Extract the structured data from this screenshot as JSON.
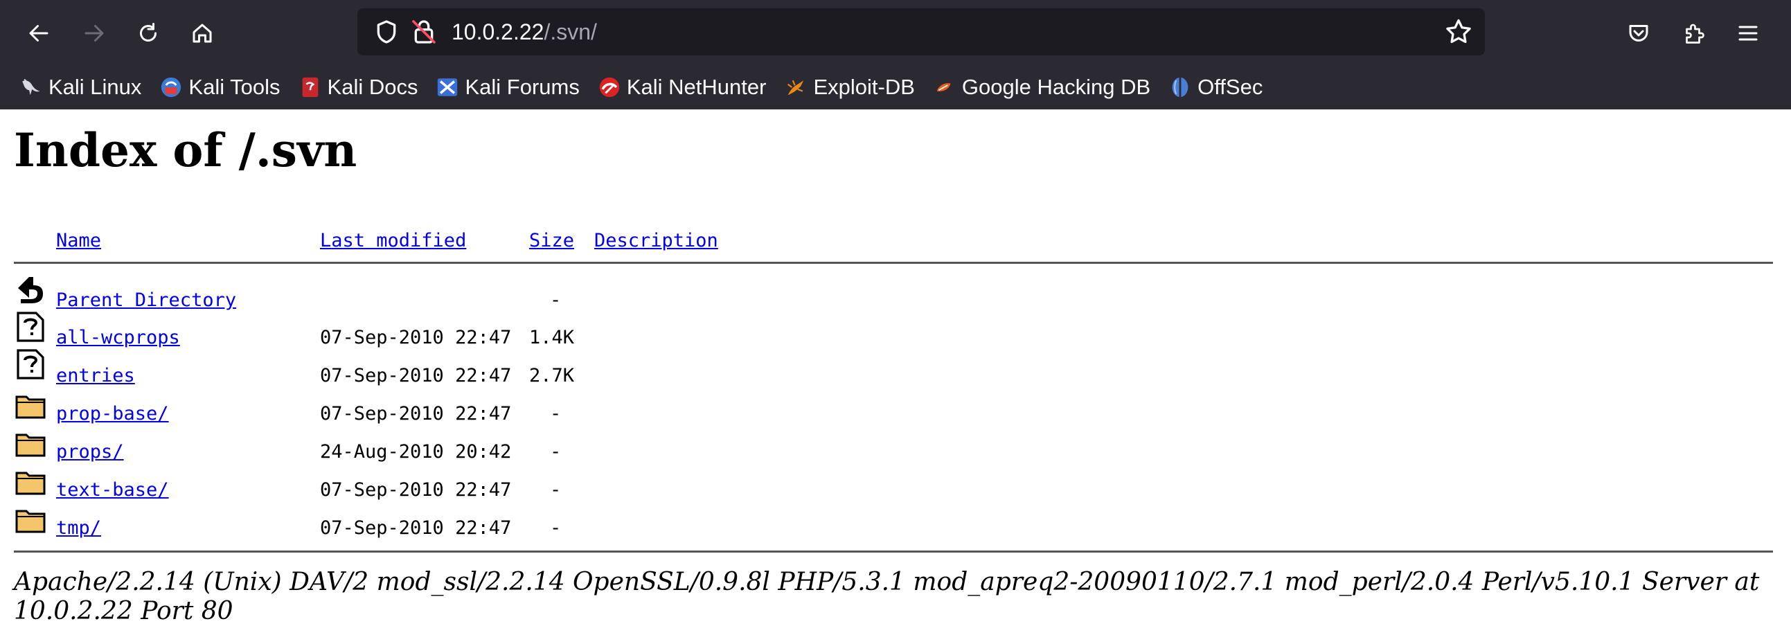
{
  "browser": {
    "url_host": "10.0.2.22",
    "url_path": "/.svn/",
    "bookmarks": [
      {
        "label": "Kali Linux",
        "icon": "kali-dragon-icon"
      },
      {
        "label": "Kali Tools",
        "icon": "kali-tools-icon"
      },
      {
        "label": "Kali Docs",
        "icon": "kali-docs-icon"
      },
      {
        "label": "Kali Forums",
        "icon": "kali-forums-icon"
      },
      {
        "label": "Kali NetHunter",
        "icon": "kali-nethunter-icon"
      },
      {
        "label": "Exploit-DB",
        "icon": "exploit-db-icon"
      },
      {
        "label": "Google Hacking DB",
        "icon": "ghdb-icon"
      },
      {
        "label": "OffSec",
        "icon": "offsec-icon"
      }
    ]
  },
  "page": {
    "title": "Index of /.svn",
    "columns": {
      "name": "Name",
      "last_modified": "Last modified",
      "size": "Size",
      "description": "Description"
    },
    "rows": [
      {
        "name": "Parent Directory",
        "date": "",
        "size": "-",
        "icon": "back-arrow-icon"
      },
      {
        "name": "all-wcprops",
        "date": "07-Sep-2010 22:47",
        "size": "1.4K",
        "icon": "unknown-file-icon"
      },
      {
        "name": "entries",
        "date": "07-Sep-2010 22:47",
        "size": "2.7K",
        "icon": "unknown-file-icon"
      },
      {
        "name": "prop-base/",
        "date": "07-Sep-2010 22:47",
        "size": "-",
        "icon": "folder-icon"
      },
      {
        "name": "props/",
        "date": "24-Aug-2010 20:42",
        "size": "-",
        "icon": "folder-icon"
      },
      {
        "name": "text-base/",
        "date": "07-Sep-2010 22:47",
        "size": "-",
        "icon": "folder-icon"
      },
      {
        "name": "tmp/",
        "date": "07-Sep-2010 22:47",
        "size": "-",
        "icon": "folder-icon"
      }
    ],
    "server_signature": "Apache/2.2.14 (Unix) DAV/2 mod_ssl/2.2.14 OpenSSL/0.9.8l PHP/5.3.1 mod_apreq2-20090110/2.7.1 mod_perl/2.0.4 Perl/v5.10.1 Server at 10.0.2.22 Port 80"
  }
}
